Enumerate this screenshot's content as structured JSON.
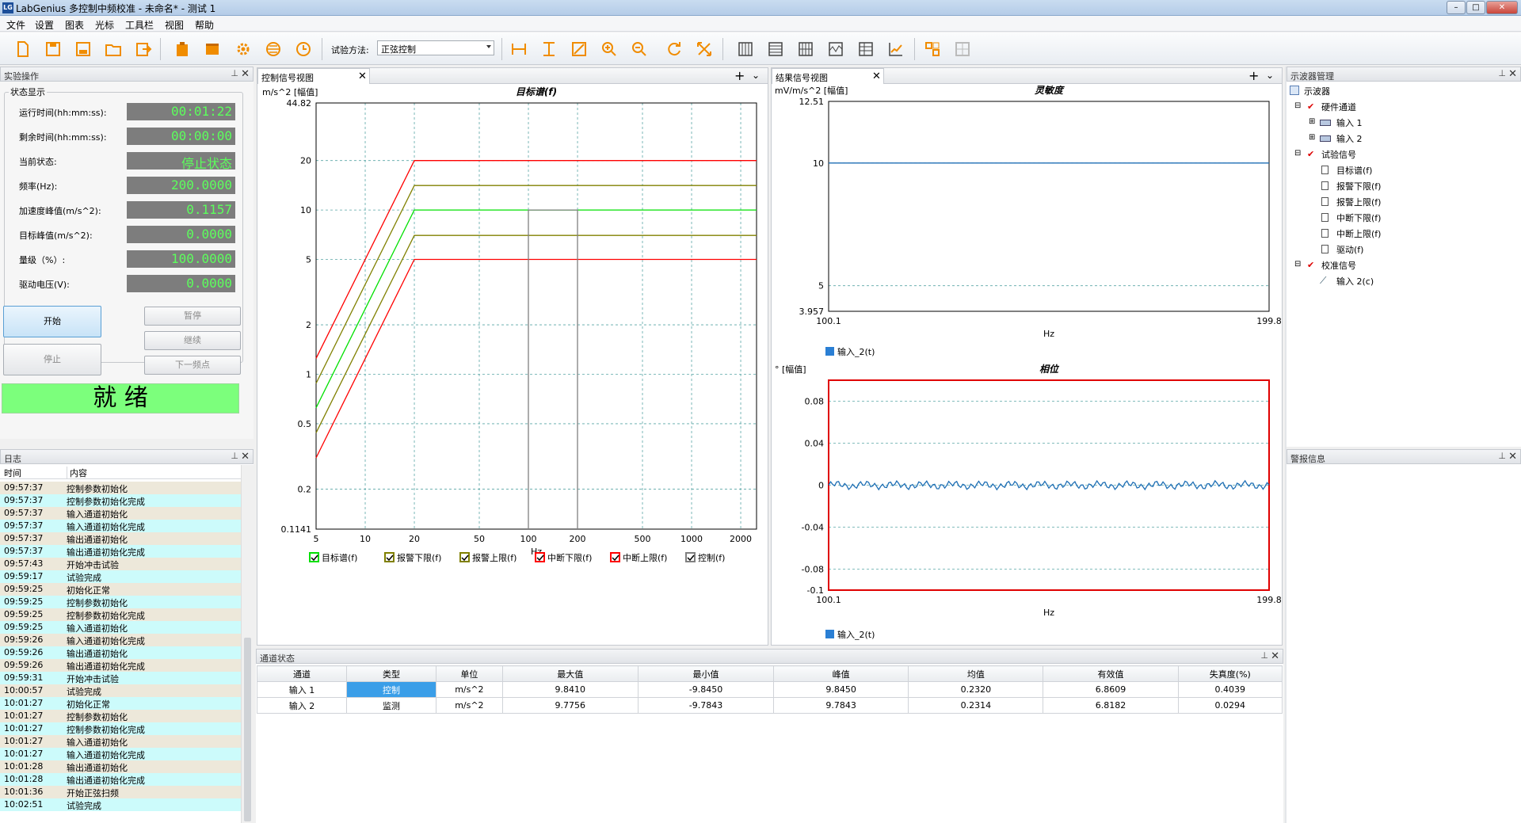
{
  "window": {
    "title": "LabGenius 多控制中频校准 - 未命名* - 测试 1"
  },
  "menu": [
    "文件",
    "设置",
    "图表",
    "光标",
    "工具栏",
    "视图",
    "帮助"
  ],
  "toolbar": {
    "method_label": "试验方法:",
    "method_value": "正弦控制"
  },
  "left_panel": {
    "title": "实验操作",
    "group_title": "状态显示",
    "rows": [
      {
        "label": "运行时间(hh:mm:ss):",
        "value": "00:01:22"
      },
      {
        "label": "剩余时间(hh:mm:ss):",
        "value": "00:00:00"
      },
      {
        "label": "当前状态:",
        "value": "停止状态"
      },
      {
        "label": "频率(Hz):",
        "value": "200.0000"
      },
      {
        "label": "加速度峰值(m/s^2):",
        "value": "0.1157"
      },
      {
        "label": "目标峰值(m/s^2):",
        "value": "0.0000"
      },
      {
        "label": "量级（%）:",
        "value": "100.0000"
      },
      {
        "label": "驱动电压(V):",
        "value": "0.0000"
      }
    ],
    "buttons": {
      "start": "开始",
      "pause": "暂停",
      "stop": "停止",
      "continue": "继续",
      "next": "下一频点"
    },
    "ready": "就 绪"
  },
  "log": {
    "title": "日志",
    "col_time": "时间",
    "col_content": "内容",
    "rows": [
      {
        "time": "09:57:37",
        "text": "控制参数初始化"
      },
      {
        "time": "09:57:37",
        "text": "控制参数初始化完成"
      },
      {
        "time": "09:57:37",
        "text": "输入通道初始化"
      },
      {
        "time": "09:57:37",
        "text": "输入通道初始化完成"
      },
      {
        "time": "09:57:37",
        "text": "输出通道初始化"
      },
      {
        "time": "09:57:37",
        "text": "输出通道初始化完成"
      },
      {
        "time": "09:57:43",
        "text": "开始冲击试验"
      },
      {
        "time": "09:59:17",
        "text": "试验完成"
      },
      {
        "time": "09:59:25",
        "text": "初始化正常"
      },
      {
        "time": "09:59:25",
        "text": "控制参数初始化"
      },
      {
        "time": "09:59:25",
        "text": "控制参数初始化完成"
      },
      {
        "time": "09:59:25",
        "text": "输入通道初始化"
      },
      {
        "time": "09:59:26",
        "text": "输入通道初始化完成"
      },
      {
        "time": "09:59:26",
        "text": "输出通道初始化"
      },
      {
        "time": "09:59:26",
        "text": "输出通道初始化完成"
      },
      {
        "time": "09:59:31",
        "text": "开始冲击试验"
      },
      {
        "time": "10:00:57",
        "text": "试验完成"
      },
      {
        "time": "10:01:27",
        "text": "初始化正常"
      },
      {
        "time": "10:01:27",
        "text": "控制参数初始化"
      },
      {
        "time": "10:01:27",
        "text": "控制参数初始化完成"
      },
      {
        "time": "10:01:27",
        "text": "输入通道初始化"
      },
      {
        "time": "10:01:27",
        "text": "输入通道初始化完成"
      },
      {
        "time": "10:01:28",
        "text": "输出通道初始化"
      },
      {
        "time": "10:01:28",
        "text": "输出通道初始化完成"
      },
      {
        "time": "10:01:36",
        "text": "开始正弦扫频"
      },
      {
        "time": "10:02:51",
        "text": "试验完成"
      }
    ]
  },
  "control_view": {
    "tab": "控制信号视图"
  },
  "result_view": {
    "tab": "结果信号视图"
  },
  "chart_data": [
    {
      "type": "line",
      "title": "目标谱(f)",
      "ylabel": "m/s^2 [幅值]",
      "xlabel": "Hz",
      "xscale": "log",
      "yscale": "log",
      "xlim": [
        5,
        2500
      ],
      "ylim": [
        0.1141,
        44.82
      ],
      "x_ticks": [
        5,
        10,
        20,
        50,
        100,
        200,
        500,
        1000,
        2000
      ],
      "y_ticks": [
        "44.82",
        "20",
        "10",
        "5",
        "2",
        "1",
        "0.5",
        "0.2",
        "0.1141"
      ],
      "grid": true,
      "legend_placement": "bottom",
      "series": [
        {
          "name": "目标谱(f)",
          "color": "#00e000",
          "x": [
            5,
            20,
            2500
          ],
          "y": [
            0.625,
            10,
            10
          ]
        },
        {
          "name": "报警下限(f)",
          "color": "#808000",
          "x": [
            5,
            20,
            2500
          ],
          "y": [
            0.44,
            7.0,
            7.0
          ]
        },
        {
          "name": "报警上限(f)",
          "color": "#808000",
          "x": [
            5,
            20,
            2500
          ],
          "y": [
            0.88,
            14.1,
            14.1
          ]
        },
        {
          "name": "中断下限(f)",
          "color": "#ff0000",
          "x": [
            5,
            20,
            2500
          ],
          "y": [
            0.31,
            5.0,
            5.0
          ]
        },
        {
          "name": "中断上限(f)",
          "color": "#ff0000",
          "x": [
            5,
            20,
            2500
          ],
          "y": [
            1.25,
            20,
            20
          ]
        },
        {
          "name": "控制(f)",
          "color": "#808080",
          "x": [
            100,
            100,
            200,
            200
          ],
          "y": [
            0.1141,
            10,
            10,
            0.1141
          ]
        }
      ]
    },
    {
      "type": "line",
      "title": "灵敏度",
      "ylabel": "mV/m/s^2 [幅值]",
      "xlabel": "Hz",
      "xlim": [
        100.1,
        199.8
      ],
      "ylim": [
        3.957,
        12.51
      ],
      "x_ticks": [
        "100.1",
        "199.8"
      ],
      "y_ticks": [
        "12.51",
        "10",
        "5",
        "3.957"
      ],
      "grid": true,
      "series": [
        {
          "name": "输入_2(t)",
          "color": "#1f6fb5",
          "x": [
            100.1,
            199.8
          ],
          "y": [
            10,
            10
          ]
        }
      ]
    },
    {
      "type": "line",
      "title": "相位",
      "ylabel": "° [幅值]",
      "xlabel": "Hz",
      "xlim": [
        100.1,
        199.8
      ],
      "ylim": [
        -0.1,
        0.1
      ],
      "x_ticks": [
        "100.1",
        "199.8"
      ],
      "y_ticks": [
        "0.08",
        "0.04",
        "0",
        "-0.04",
        "-0.08",
        "-0.1"
      ],
      "grid": true,
      "series": [
        {
          "name": "输入_2(t)",
          "color": "#1f6fb5",
          "x": [
            100.1,
            199.8
          ],
          "y": [
            0,
            0
          ]
        }
      ]
    }
  ],
  "oscilloscope": {
    "title": "示波器管理",
    "nodes": [
      "示波器",
      "硬件通道",
      "输入 1",
      "输入 2",
      "试验信号",
      "目标谱(f)",
      "报警下限(f)",
      "报警上限(f)",
      "中断下限(f)",
      "中断上限(f)",
      "驱动(f)",
      "校准信号",
      "输入 2(c)"
    ]
  },
  "alarm": {
    "title": "警报信息"
  },
  "channel_status": {
    "title": "通道状态",
    "headers": [
      "通道",
      "类型",
      "单位",
      "最大值",
      "最小值",
      "峰值",
      "均值",
      "有效值",
      "失真度(%)"
    ],
    "rows": [
      [
        "输入 1",
        "控制",
        "m/s^2",
        "9.8410",
        "-9.8450",
        "9.8450",
        "0.2320",
        "6.8609",
        "0.4039"
      ],
      [
        "输入 2",
        "监测",
        "m/s^2",
        "9.7756",
        "-9.7843",
        "9.7843",
        "0.2314",
        "6.8182",
        "0.0294"
      ]
    ]
  }
}
